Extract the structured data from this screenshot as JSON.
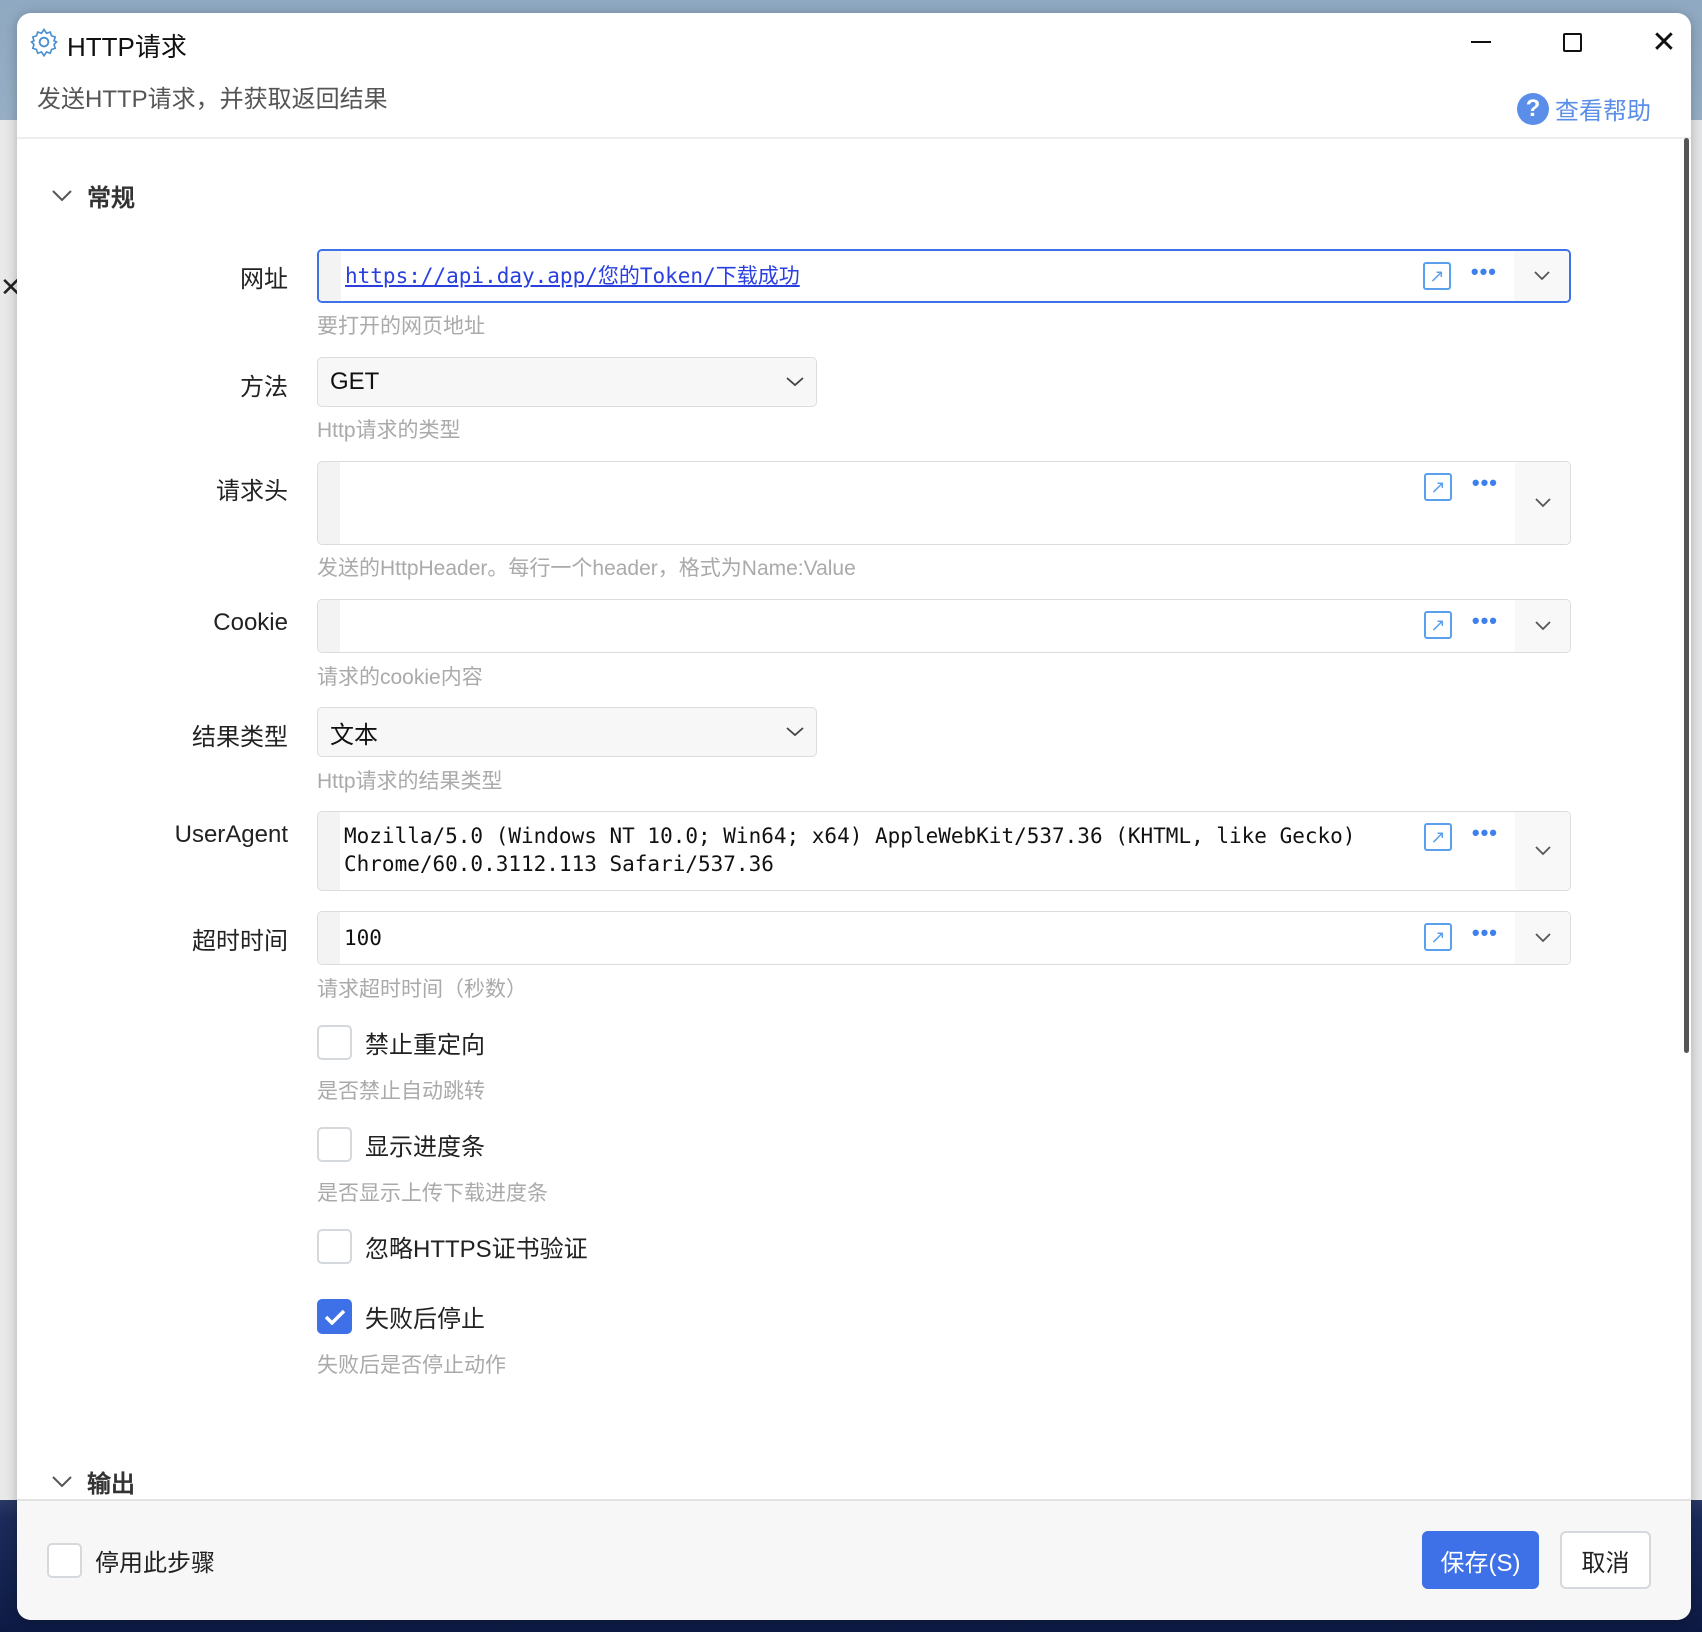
{
  "window": {
    "title": "HTTP请求",
    "subtitle": "发送HTTP请求，并获取返回结果",
    "help": "查看帮助"
  },
  "sections": {
    "general": "常规",
    "output": "输出"
  },
  "fields": {
    "url": {
      "label": "网址",
      "value": "https://api.day.app/您的Token/下载成功",
      "hint": "要打开的网页地址"
    },
    "method": {
      "label": "方法",
      "value": "GET",
      "hint": "Http请求的类型"
    },
    "headers": {
      "label": "请求头",
      "value": "",
      "hint": "发送的HttpHeader。每行一个header，格式为Name:Value"
    },
    "cookie": {
      "label": "Cookie",
      "value": "",
      "hint": "请求的cookie内容"
    },
    "result_type": {
      "label": "结果类型",
      "value": "文本",
      "hint": "Http请求的结果类型"
    },
    "user_agent": {
      "label": "UserAgent",
      "value_line1": "Mozilla/5.0 (Windows NT 10.0; Win64; x64) AppleWebKit/537.36 (KHTML, like Gecko)",
      "value_line2": "Chrome/60.0.3112.113 Safari/537.36"
    },
    "timeout": {
      "label": "超时时间",
      "value": "100",
      "hint": "请求超时时间（秒数）"
    }
  },
  "checkboxes": [
    {
      "label": "禁止重定向",
      "checked": false,
      "hint": "是否禁止自动跳转"
    },
    {
      "label": "显示进度条",
      "checked": false,
      "hint": "是否显示上传下载进度条"
    },
    {
      "label": "忽略HTTPS证书验证",
      "checked": false,
      "hint": ""
    },
    {
      "label": "失败后停止",
      "checked": true,
      "hint": "失败后是否停止动作"
    }
  ],
  "footer": {
    "disable_step": "停用此步骤",
    "save": "保存(S)",
    "cancel": "取消"
  },
  "colors": {
    "accent": "#3e70e8",
    "link": "#2a3fe0"
  }
}
